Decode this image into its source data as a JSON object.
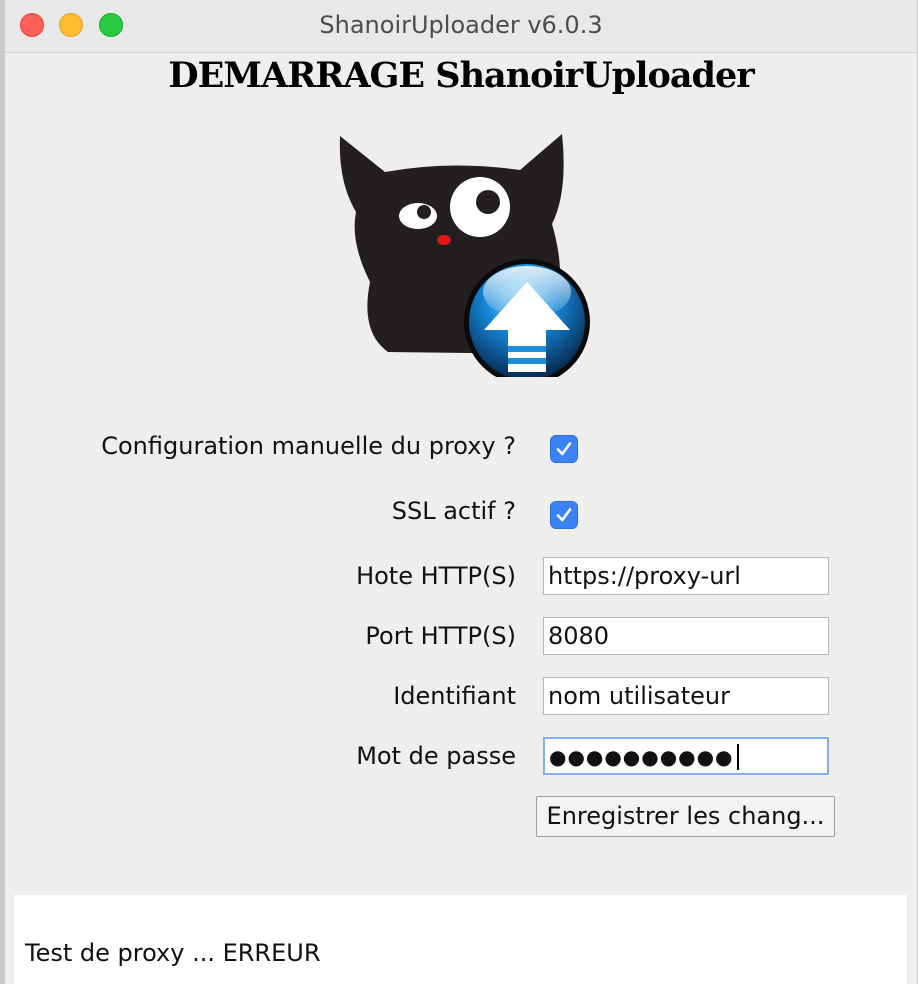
{
  "window": {
    "title": "ShanoirUploader v6.0.3"
  },
  "heading": "DEMARRAGE ShanoirUploader",
  "logo": {
    "icon": "cat-upload-logo-icon"
  },
  "proxy_form": {
    "manual_proxy": {
      "label": "Configuration manuelle du proxy ?",
      "checked": true
    },
    "ssl_active": {
      "label": "SSL actif ?",
      "checked": true
    },
    "host": {
      "label": "Hote HTTP(S)",
      "value": "https://proxy-url"
    },
    "port": {
      "label": "Port HTTP(S)",
      "value": "8080"
    },
    "username": {
      "label": "Identifiant",
      "value": "nom utilisateur"
    },
    "password": {
      "label": "Mot de passe",
      "value": "●●●●●●●●●●"
    },
    "save_button": "Enregistrer les chang..."
  },
  "status": {
    "text": "Test de proxy ... ERREUR"
  },
  "colors": {
    "checkbox_accent": "#3b82f7",
    "focus_ring": "#84aee8"
  }
}
